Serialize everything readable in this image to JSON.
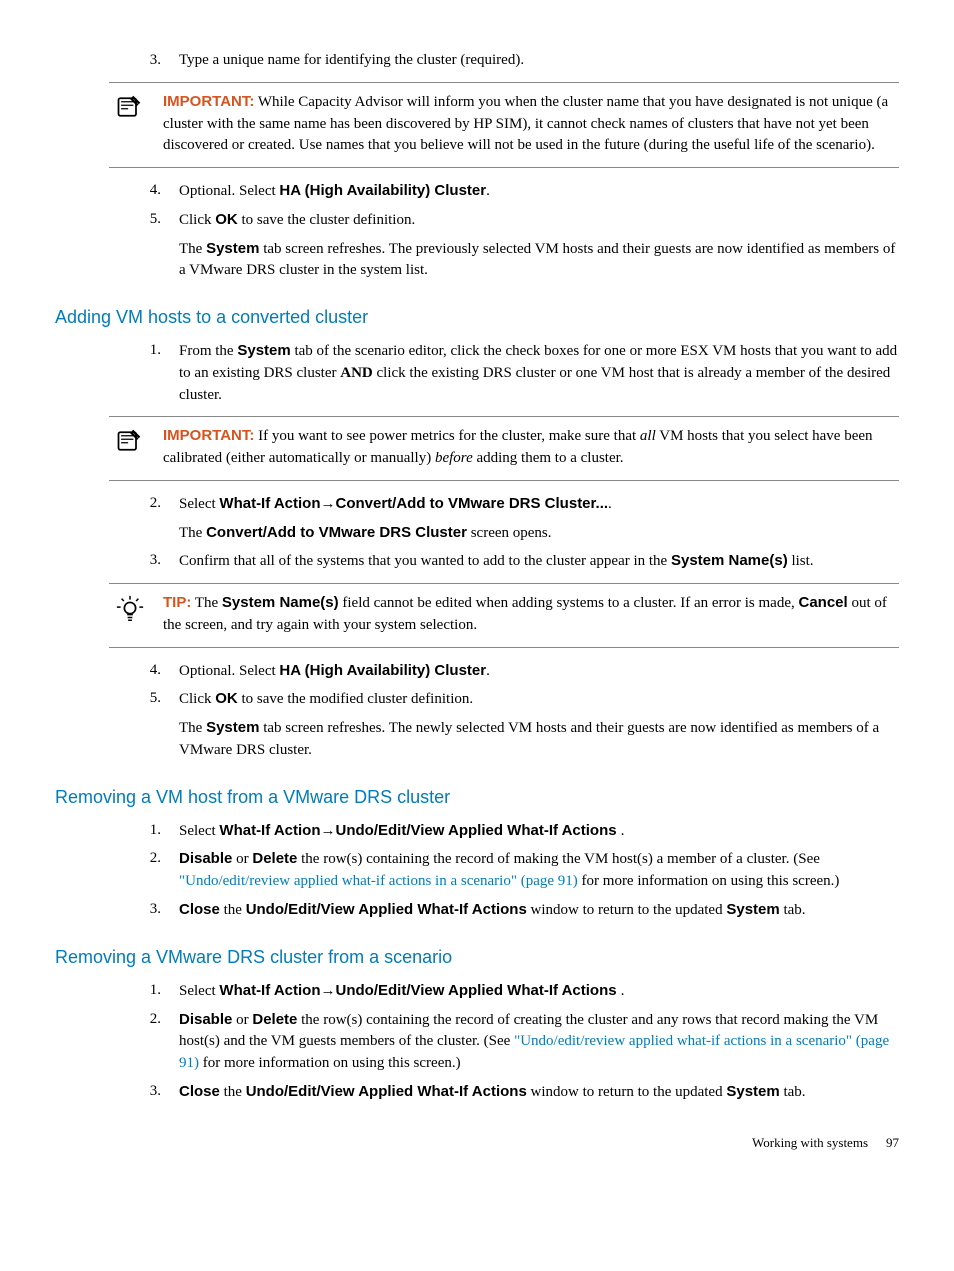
{
  "top": {
    "step3_num": "3.",
    "step3_text": "Type a unique name for identifying the cluster (required).",
    "important_label": "IMPORTANT:",
    "important_text": "   While Capacity Advisor will inform you when the cluster name that you have designated is not unique (a cluster with the same name has been discovered by HP SIM), it cannot check names of clusters that have not yet been discovered or created. Use names that you believe will not be used in the future (during the useful life of the scenario).",
    "step4_num": "4.",
    "step4_a": "Optional. Select ",
    "step4_b": "HA (High Availability) Cluster",
    "step4_c": ".",
    "step5_num": "5.",
    "step5_a": "Click ",
    "step5_b": "OK",
    "step5_c": " to save the cluster definition.",
    "step5_para_a": "The ",
    "step5_para_b": "System",
    "step5_para_c": " tab screen refreshes. The previously selected VM hosts and their guests are now identified as members of a VMware DRS cluster in the system list."
  },
  "sec1": {
    "heading": "Adding VM hosts to a converted cluster",
    "step1_num": "1.",
    "step1_a": "From the ",
    "step1_b": "System",
    "step1_c": " tab of the scenario editor, click the check boxes for one or more ESX VM hosts that you want to add to an existing DRS cluster ",
    "step1_d": "AND",
    "step1_e": " click the existing DRS cluster or one VM host that is already a member of the desired cluster.",
    "important_label": "IMPORTANT:",
    "important_a": "   If you want to see power metrics for the cluster, make sure that ",
    "important_b": "all",
    "important_c": " VM hosts that you select have been calibrated (either automatically or manually) ",
    "important_d": "before",
    "important_e": " adding them to a cluster.",
    "step2_num": "2.",
    "step2_a": "Select ",
    "step2_b": "What-If Action",
    "step2_arrow": "→",
    "step2_c": "Convert/Add to VMware DRS Cluster...",
    "step2_d": ".",
    "step2_para_a": "The ",
    "step2_para_b": "Convert/Add to VMware DRS Cluster",
    "step2_para_c": " screen opens.",
    "step3_num": "3.",
    "step3_a": "Confirm that all of the systems that you wanted to add to the cluster appear in the ",
    "step3_b": "System Name(s)",
    "step3_c": " list.",
    "tip_label": "TIP:",
    "tip_a": "   The ",
    "tip_b": "System Name(s)",
    "tip_c": " field cannot be edited when adding systems to a cluster. If an error is made, ",
    "tip_d": "Cancel",
    "tip_e": " out of the screen, and try again with your system selection.",
    "step4_num": "4.",
    "step4_a": "Optional. Select ",
    "step4_b": "HA (High Availability) Cluster",
    "step4_c": ".",
    "step5_num": "5.",
    "step5_a": "Click ",
    "step5_b": "OK",
    "step5_c": " to save the modified cluster definition.",
    "step5_para_a": "The ",
    "step5_para_b": "System",
    "step5_para_c": " tab screen refreshes. The newly selected VM hosts and their guests are now identified as members of a VMware DRS cluster."
  },
  "sec2": {
    "heading": "Removing a VM host from a VMware DRS cluster",
    "step1_num": "1.",
    "step1_a": "Select ",
    "step1_b": "What-If Action",
    "step1_arrow": "→",
    "step1_c": "Undo/Edit/View Applied What-If Actions ",
    "step1_d": ".",
    "step2_num": "2.",
    "step2_a": "Disable",
    "step2_b": " or ",
    "step2_c": "Delete",
    "step2_d": " the row(s) containing the record of making the VM host(s) a member of a cluster. (See ",
    "step2_link": "\"Undo/edit/review applied what-if actions in a scenario\" (page 91)",
    "step2_e": " for more information on using this screen.)",
    "step3_num": "3.",
    "step3_a": "Close",
    "step3_b": " the ",
    "step3_c": "Undo/Edit/View Applied What-If Actions",
    "step3_d": " window to return to the updated ",
    "step3_e": "System",
    "step3_f": " tab."
  },
  "sec3": {
    "heading": "Removing a VMware DRS cluster from a scenario",
    "step1_num": "1.",
    "step1_a": "Select ",
    "step1_b": "What-If Action",
    "step1_arrow": "→",
    "step1_c": "Undo/Edit/View Applied What-If Actions ",
    "step1_d": ".",
    "step2_num": "2.",
    "step2_a": "Disable",
    "step2_b": " or ",
    "step2_c": "Delete",
    "step2_d": " the row(s) containing the record of creating the cluster and any rows that record making the VM host(s) and the VM guests members of the cluster. (See ",
    "step2_link": "\"Undo/edit/review applied what-if actions in a scenario\" (page 91)",
    "step2_e": " for more information on using this screen.)",
    "step3_num": "3.",
    "step3_a": "Close",
    "step3_b": " the ",
    "step3_c": "Undo/Edit/View Applied What-If Actions",
    "step3_d": " window to return to the updated ",
    "step3_e": "System",
    "step3_f": " tab."
  },
  "footer": {
    "text": "Working with systems",
    "page": "97"
  }
}
